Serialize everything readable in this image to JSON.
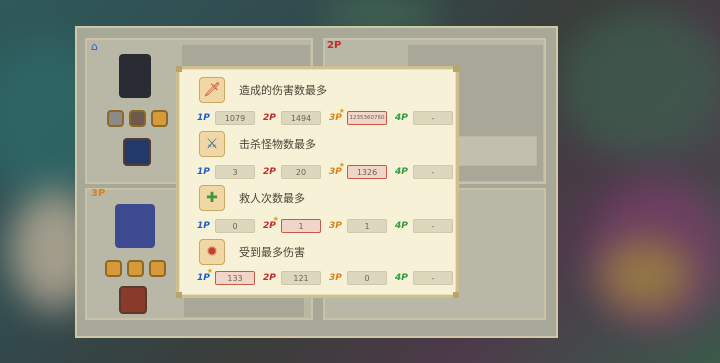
{
  "background": {
    "players": [
      {
        "tag": "",
        "tag_icon": "home-icon"
      },
      {
        "tag": "2P"
      },
      {
        "tag": "3P"
      }
    ]
  },
  "popup": {
    "rows": [
      {
        "icon": "sword-icon",
        "title": "造成的伤害数最多",
        "stats": [
          {
            "player": "1P",
            "value": "1079"
          },
          {
            "player": "2P",
            "value": "1494"
          },
          {
            "player": "3P",
            "value": "1235360760",
            "best": true
          },
          {
            "player": "4P",
            "value": "-"
          }
        ]
      },
      {
        "icon": "monster-kill-icon",
        "title": "击杀怪物数最多",
        "stats": [
          {
            "player": "1P",
            "value": "3"
          },
          {
            "player": "2P",
            "value": "20"
          },
          {
            "player": "3P",
            "value": "1326",
            "best": true
          },
          {
            "player": "4P",
            "value": "-"
          }
        ]
      },
      {
        "icon": "rescue-icon",
        "title": "救人次数最多",
        "stats": [
          {
            "player": "1P",
            "value": "0"
          },
          {
            "player": "2P",
            "value": "1",
            "best": true
          },
          {
            "player": "3P",
            "value": "1"
          },
          {
            "player": "4P",
            "value": "-"
          }
        ]
      },
      {
        "icon": "damage-taken-icon",
        "title": "受到最多伤害",
        "stats": [
          {
            "player": "1P",
            "value": "133",
            "best": true
          },
          {
            "player": "2P",
            "value": "121"
          },
          {
            "player": "3P",
            "value": "0"
          },
          {
            "player": "4P",
            "value": "-"
          }
        ]
      }
    ]
  },
  "colors": {
    "p1": "#1f5fc7",
    "p2": "#c62b2b",
    "p3": "#d8821a",
    "p4": "#2f9a3a",
    "highlight_border": "#c25b4a"
  }
}
